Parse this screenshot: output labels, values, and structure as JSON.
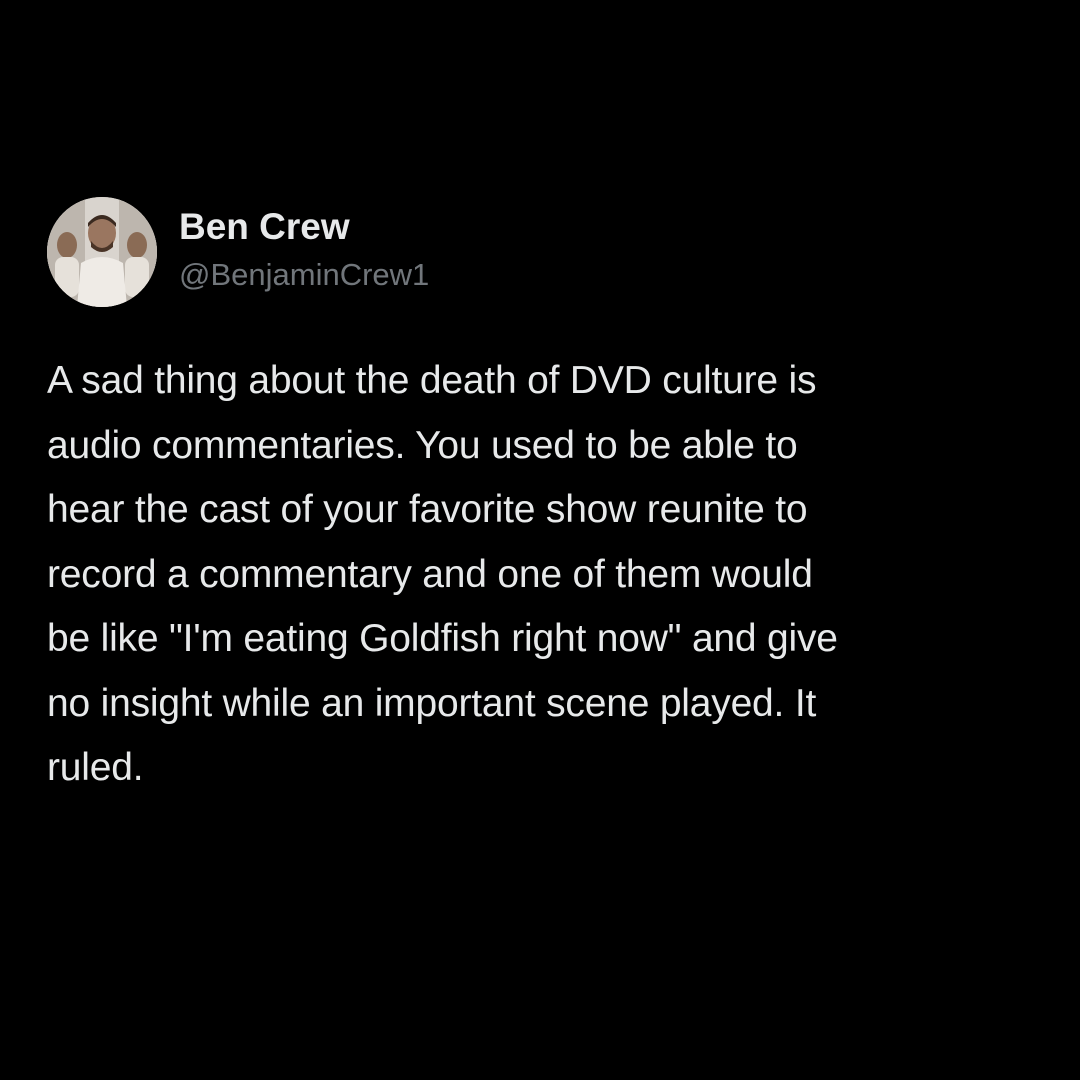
{
  "colors": {
    "background": "#000000",
    "text_primary": "#e7e9ea",
    "text_secondary": "#71767b"
  },
  "author": {
    "display_name": "Ben Crew",
    "handle": "@BenjaminCrew1",
    "avatar": "profile-photo"
  },
  "tweet": {
    "lines": [
      "A sad thing about the death of DVD culture is",
      "audio commentaries. You used to be able to",
      "hear the cast of your favorite show reunite to",
      "record a commentary and one of them would",
      "be like \"I'm eating Goldfish right now\" and give",
      "no insight while an important scene played. It",
      "ruled."
    ]
  }
}
